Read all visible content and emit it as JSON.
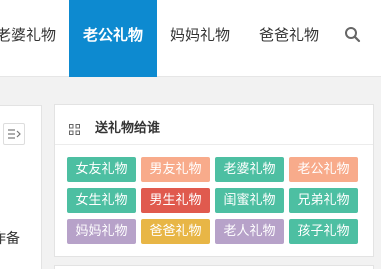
{
  "nav": {
    "items": [
      "老婆礼物",
      "老公礼物",
      "妈妈礼物",
      "爸爸礼物"
    ],
    "active_index": 1,
    "active_color": "#0d8ad0",
    "search_icon": "magnifier"
  },
  "left": {
    "toggle_icon": "list-collapse",
    "cut_text": "作备"
  },
  "widget": {
    "icon": "grid-icon",
    "title": "送礼物给谁",
    "tags": [
      {
        "label": "女友礼物",
        "color": "#4dbfa2"
      },
      {
        "label": "男友礼物",
        "color": "#f8ab8b"
      },
      {
        "label": "老婆礼物",
        "color": "#4dbfa2"
      },
      {
        "label": "老公礼物",
        "color": "#f8ab8b"
      },
      {
        "label": "女生礼物",
        "color": "#4dbfa2"
      },
      {
        "label": "男生礼物",
        "color": "#e05a4e"
      },
      {
        "label": "闺蜜礼物",
        "color": "#4dbfa2"
      },
      {
        "label": "兄弟礼物",
        "color": "#4dbfa2"
      },
      {
        "label": "妈妈礼物",
        "color": "#b7a2c9"
      },
      {
        "label": "爸爸礼物",
        "color": "#e8b646"
      },
      {
        "label": "老人礼物",
        "color": "#b7a2c9"
      },
      {
        "label": "孩子礼物",
        "color": "#4dbfa2"
      }
    ]
  }
}
